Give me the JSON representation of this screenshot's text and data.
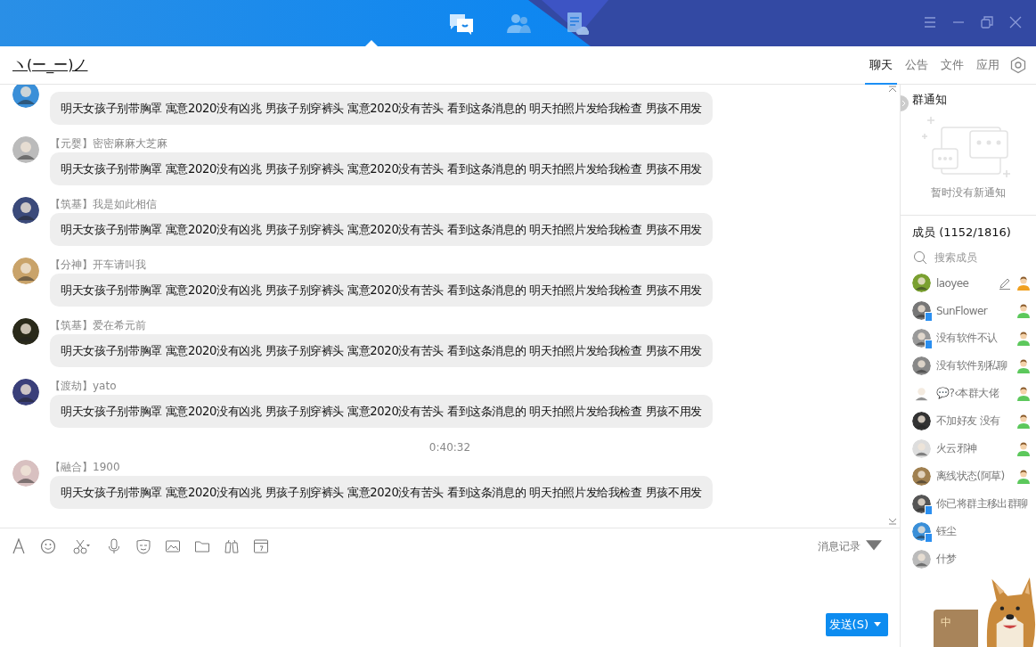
{
  "nav_tabs": [
    {
      "kind": "chat",
      "selected": true
    },
    {
      "kind": "contacts",
      "selected": false
    },
    {
      "kind": "notes",
      "selected": false
    }
  ],
  "group_title": "ヽ(ー_ー)ノ",
  "tabs": [
    {
      "label": "聊天",
      "selected": true
    },
    {
      "label": "公告",
      "selected": false
    },
    {
      "label": "文件",
      "selected": false
    },
    {
      "label": "应用",
      "selected": false
    }
  ],
  "messages": [
    {
      "kind": "message",
      "text": "明天女孩子别带胸罩 寓意2020没有凶兆 男孩子别穿裤头 寓意2020没有苦头 看到这条消息的 明天拍照片发给我检查 男孩不用发"
    },
    {
      "kind": "message",
      "sender": "【元婴】密密麻麻大芝麻",
      "text": "明天女孩子别带胸罩 寓意2020没有凶兆 男孩子别穿裤头 寓意2020没有苦头 看到这条消息的 明天拍照片发给我检查 男孩不用发"
    },
    {
      "kind": "message",
      "sender": "【筑基】我是如此相信",
      "text": "明天女孩子别带胸罩 寓意2020没有凶兆 男孩子别穿裤头 寓意2020没有苦头 看到这条消息的 明天拍照片发给我检查 男孩不用发"
    },
    {
      "kind": "message",
      "sender": "【分神】开车请叫我",
      "text": "明天女孩子别带胸罩 寓意2020没有凶兆 男孩子别穿裤头 寓意2020没有苦头 看到这条消息的 明天拍照片发给我检查 男孩不用发"
    },
    {
      "kind": "message",
      "sender": "【筑基】爱在希元前",
      "text": "明天女孩子别带胸罩 寓意2020没有凶兆 男孩子别穿裤头 寓意2020没有苦头 看到这条消息的 明天拍照片发给我检查 男孩不用发"
    },
    {
      "kind": "message",
      "sender": "【渡劫】yato",
      "text": "明天女孩子别带胸罩 寓意2020没有凶兆 男孩子别穿裤头 寓意2020没有苦头 看到这条消息的 明天拍照片发给我检查 男孩不用发"
    },
    {
      "kind": "time",
      "text": "0:40:32"
    },
    {
      "kind": "message",
      "sender": "【融合】1900",
      "text": "明天女孩子别带胸罩 寓意2020没有凶兆 男孩子别穿裤头 寓意2020没有苦头 看到这条消息的 明天拍照片发给我检查 男孩不用发"
    }
  ],
  "history_link": "消息记录",
  "send_button": "发送(S)",
  "notice": {
    "title": "群通知",
    "empty": "暂时没有新通知"
  },
  "members_title": "成员 (1152/1816)",
  "member_search": {
    "placeholder": "搜索成员"
  },
  "members": [
    {
      "name": "laoyee",
      "kind": "admin",
      "mobile": false,
      "editable": true
    },
    {
      "name": "SunFlower",
      "kind": "member",
      "mobile": true,
      "editable": false
    },
    {
      "name": "没有软件不认",
      "kind": "member",
      "mobile": true,
      "editable": false
    },
    {
      "name": "没有软件别私聊",
      "kind": "member",
      "mobile": false,
      "editable": false
    },
    {
      "name": "💬?‹本群大佬",
      "kind": "member",
      "mobile": false,
      "editable": false
    },
    {
      "name": "不加好友 没有",
      "kind": "member",
      "mobile": false,
      "editable": false
    },
    {
      "name": "火云邪神",
      "kind": "member",
      "mobile": false,
      "editable": false
    },
    {
      "name": "离线状态(阿草)",
      "kind": "member",
      "mobile": false,
      "editable": false
    },
    {
      "name": "你已将群主移出群聊",
      "kind": "plain",
      "mobile": true,
      "editable": false
    },
    {
      "name": "钰尘",
      "kind": "plain",
      "mobile": true,
      "editable": false
    },
    {
      "name": "什梦",
      "kind": "plain",
      "mobile": false,
      "editable": false
    }
  ],
  "ime_bar": {
    "label": "中"
  }
}
